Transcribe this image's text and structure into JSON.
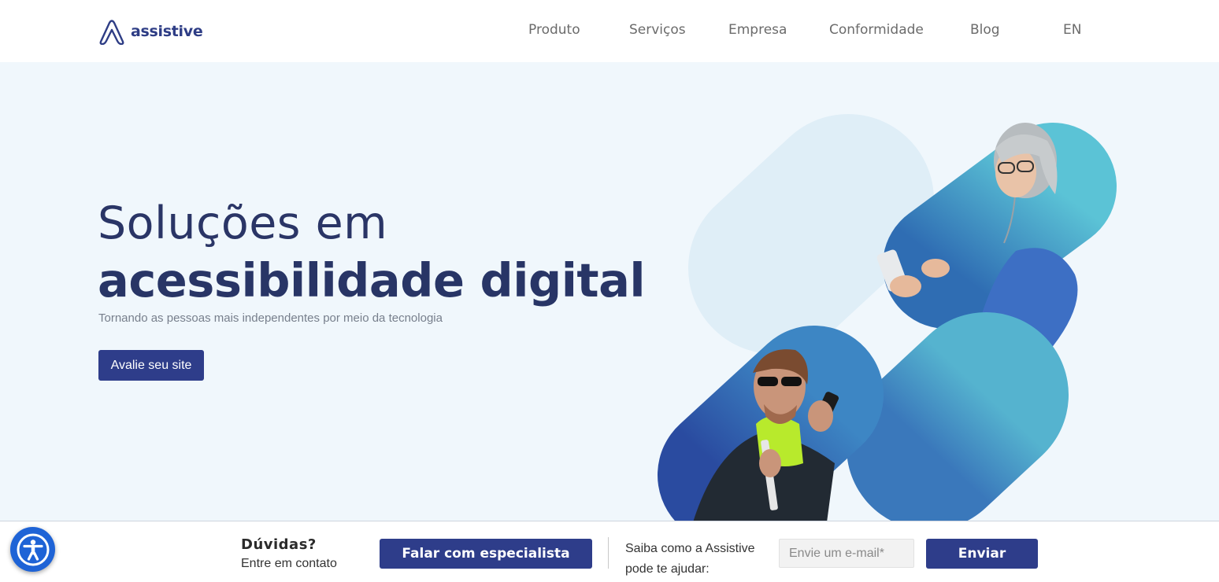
{
  "header": {
    "logo_text": "assistive",
    "nav": [
      {
        "label": "Produto"
      },
      {
        "label": "Serviços"
      },
      {
        "label": "Empresa"
      },
      {
        "label": "Conformidade"
      },
      {
        "label": "Blog"
      },
      {
        "label": "EN"
      }
    ]
  },
  "hero": {
    "title_light": "Soluções em",
    "title_bold": "acessibilidade digital",
    "subtitle": "Tornando as pessoas mais independentes por meio da tecnologia",
    "cta_label": "Avalie seu site"
  },
  "bottom_bar": {
    "question_title": "Dúvidas?",
    "question_sub": "Entre em contato",
    "specialist_button": "Falar com especialista",
    "help_line1": "Saiba como a Assistive",
    "help_line2": "pode te ajudar:",
    "email_placeholder": "Envie um e-mail*",
    "send_button": "Enviar"
  },
  "icons": {
    "logo": "assistive-logo-icon",
    "accessibility": "accessibility-person-icon"
  },
  "colors": {
    "brand": "#2e3d8a",
    "hero_background": "#f0f7fc",
    "accessibility_button": "#1e63d6"
  }
}
